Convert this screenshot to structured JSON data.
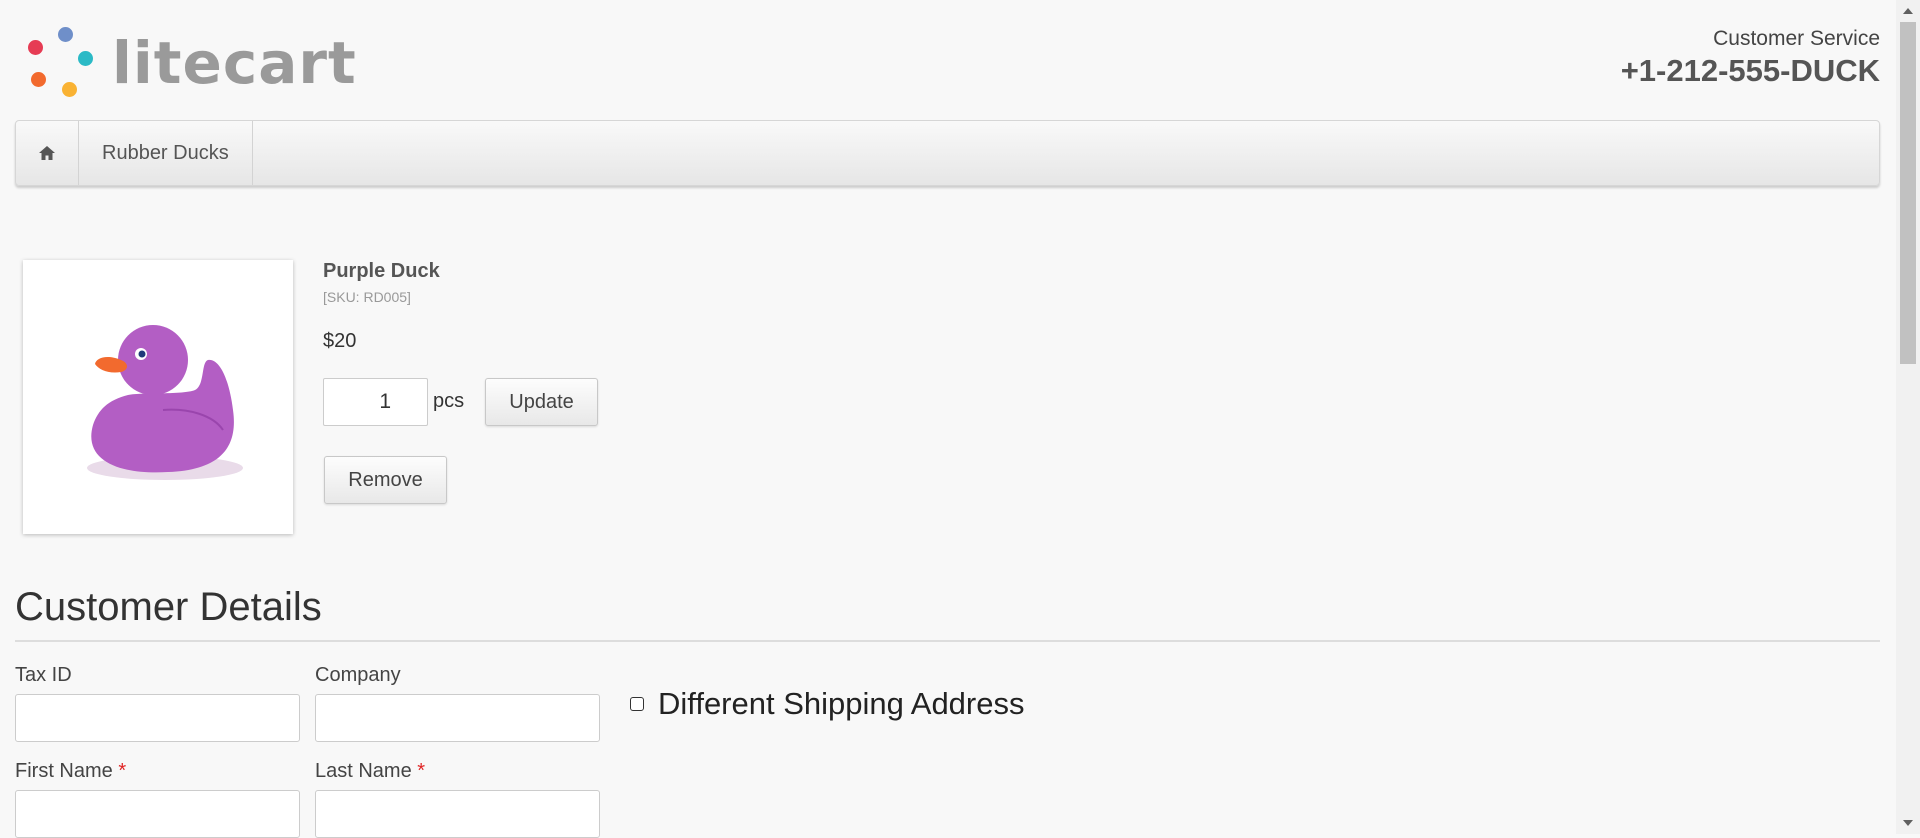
{
  "header": {
    "logo_text": "litecart",
    "customer_service_label": "Customer Service",
    "phone": "+1-212-555-DUCK",
    "logo_colors": [
      "#e63c54",
      "#6f8fc9",
      "#2bbac6",
      "#f26a2e",
      "#f9b233"
    ]
  },
  "nav": {
    "home_icon": "home-icon",
    "items": [
      {
        "label": "Rubber Ducks"
      }
    ]
  },
  "cart": {
    "item": {
      "name": "Purple Duck",
      "sku": "[SKU: RD005]",
      "price": "$20",
      "quantity": "1",
      "unit": "pcs",
      "update_label": "Update",
      "remove_label": "Remove",
      "image_color": "#b35ec4"
    }
  },
  "customer": {
    "title": "Customer Details",
    "fields": {
      "tax_id": "Tax ID",
      "company": "Company",
      "first_name": "First Name",
      "last_name": "Last Name",
      "required_marker": "*"
    },
    "different_shipping_label": "Different Shipping Address"
  }
}
